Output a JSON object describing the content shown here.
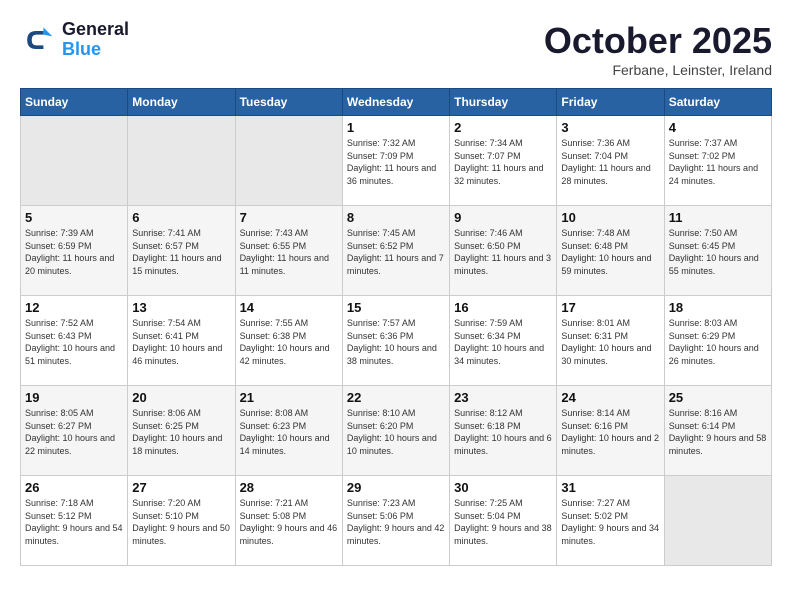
{
  "header": {
    "logo_line1": "General",
    "logo_line2": "Blue",
    "title": "October 2025",
    "subtitle": "Ferbane, Leinster, Ireland"
  },
  "days_of_week": [
    "Sunday",
    "Monday",
    "Tuesday",
    "Wednesday",
    "Thursday",
    "Friday",
    "Saturday"
  ],
  "weeks": [
    [
      {
        "day": "",
        "sunrise": "",
        "sunset": "",
        "daylight": "",
        "empty": true
      },
      {
        "day": "",
        "sunrise": "",
        "sunset": "",
        "daylight": "",
        "empty": true
      },
      {
        "day": "",
        "sunrise": "",
        "sunset": "",
        "daylight": "",
        "empty": true
      },
      {
        "day": "1",
        "sunrise": "Sunrise: 7:32 AM",
        "sunset": "Sunset: 7:09 PM",
        "daylight": "Daylight: 11 hours and 36 minutes."
      },
      {
        "day": "2",
        "sunrise": "Sunrise: 7:34 AM",
        "sunset": "Sunset: 7:07 PM",
        "daylight": "Daylight: 11 hours and 32 minutes."
      },
      {
        "day": "3",
        "sunrise": "Sunrise: 7:36 AM",
        "sunset": "Sunset: 7:04 PM",
        "daylight": "Daylight: 11 hours and 28 minutes."
      },
      {
        "day": "4",
        "sunrise": "Sunrise: 7:37 AM",
        "sunset": "Sunset: 7:02 PM",
        "daylight": "Daylight: 11 hours and 24 minutes."
      }
    ],
    [
      {
        "day": "5",
        "sunrise": "Sunrise: 7:39 AM",
        "sunset": "Sunset: 6:59 PM",
        "daylight": "Daylight: 11 hours and 20 minutes."
      },
      {
        "day": "6",
        "sunrise": "Sunrise: 7:41 AM",
        "sunset": "Sunset: 6:57 PM",
        "daylight": "Daylight: 11 hours and 15 minutes."
      },
      {
        "day": "7",
        "sunrise": "Sunrise: 7:43 AM",
        "sunset": "Sunset: 6:55 PM",
        "daylight": "Daylight: 11 hours and 11 minutes."
      },
      {
        "day": "8",
        "sunrise": "Sunrise: 7:45 AM",
        "sunset": "Sunset: 6:52 PM",
        "daylight": "Daylight: 11 hours and 7 minutes."
      },
      {
        "day": "9",
        "sunrise": "Sunrise: 7:46 AM",
        "sunset": "Sunset: 6:50 PM",
        "daylight": "Daylight: 11 hours and 3 minutes."
      },
      {
        "day": "10",
        "sunrise": "Sunrise: 7:48 AM",
        "sunset": "Sunset: 6:48 PM",
        "daylight": "Daylight: 10 hours and 59 minutes."
      },
      {
        "day": "11",
        "sunrise": "Sunrise: 7:50 AM",
        "sunset": "Sunset: 6:45 PM",
        "daylight": "Daylight: 10 hours and 55 minutes."
      }
    ],
    [
      {
        "day": "12",
        "sunrise": "Sunrise: 7:52 AM",
        "sunset": "Sunset: 6:43 PM",
        "daylight": "Daylight: 10 hours and 51 minutes."
      },
      {
        "day": "13",
        "sunrise": "Sunrise: 7:54 AM",
        "sunset": "Sunset: 6:41 PM",
        "daylight": "Daylight: 10 hours and 46 minutes."
      },
      {
        "day": "14",
        "sunrise": "Sunrise: 7:55 AM",
        "sunset": "Sunset: 6:38 PM",
        "daylight": "Daylight: 10 hours and 42 minutes."
      },
      {
        "day": "15",
        "sunrise": "Sunrise: 7:57 AM",
        "sunset": "Sunset: 6:36 PM",
        "daylight": "Daylight: 10 hours and 38 minutes."
      },
      {
        "day": "16",
        "sunrise": "Sunrise: 7:59 AM",
        "sunset": "Sunset: 6:34 PM",
        "daylight": "Daylight: 10 hours and 34 minutes."
      },
      {
        "day": "17",
        "sunrise": "Sunrise: 8:01 AM",
        "sunset": "Sunset: 6:31 PM",
        "daylight": "Daylight: 10 hours and 30 minutes."
      },
      {
        "day": "18",
        "sunrise": "Sunrise: 8:03 AM",
        "sunset": "Sunset: 6:29 PM",
        "daylight": "Daylight: 10 hours and 26 minutes."
      }
    ],
    [
      {
        "day": "19",
        "sunrise": "Sunrise: 8:05 AM",
        "sunset": "Sunset: 6:27 PM",
        "daylight": "Daylight: 10 hours and 22 minutes."
      },
      {
        "day": "20",
        "sunrise": "Sunrise: 8:06 AM",
        "sunset": "Sunset: 6:25 PM",
        "daylight": "Daylight: 10 hours and 18 minutes."
      },
      {
        "day": "21",
        "sunrise": "Sunrise: 8:08 AM",
        "sunset": "Sunset: 6:23 PM",
        "daylight": "Daylight: 10 hours and 14 minutes."
      },
      {
        "day": "22",
        "sunrise": "Sunrise: 8:10 AM",
        "sunset": "Sunset: 6:20 PM",
        "daylight": "Daylight: 10 hours and 10 minutes."
      },
      {
        "day": "23",
        "sunrise": "Sunrise: 8:12 AM",
        "sunset": "Sunset: 6:18 PM",
        "daylight": "Daylight: 10 hours and 6 minutes."
      },
      {
        "day": "24",
        "sunrise": "Sunrise: 8:14 AM",
        "sunset": "Sunset: 6:16 PM",
        "daylight": "Daylight: 10 hours and 2 minutes."
      },
      {
        "day": "25",
        "sunrise": "Sunrise: 8:16 AM",
        "sunset": "Sunset: 6:14 PM",
        "daylight": "Daylight: 9 hours and 58 minutes."
      }
    ],
    [
      {
        "day": "26",
        "sunrise": "Sunrise: 7:18 AM",
        "sunset": "Sunset: 5:12 PM",
        "daylight": "Daylight: 9 hours and 54 minutes."
      },
      {
        "day": "27",
        "sunrise": "Sunrise: 7:20 AM",
        "sunset": "Sunset: 5:10 PM",
        "daylight": "Daylight: 9 hours and 50 minutes."
      },
      {
        "day": "28",
        "sunrise": "Sunrise: 7:21 AM",
        "sunset": "Sunset: 5:08 PM",
        "daylight": "Daylight: 9 hours and 46 minutes."
      },
      {
        "day": "29",
        "sunrise": "Sunrise: 7:23 AM",
        "sunset": "Sunset: 5:06 PM",
        "daylight": "Daylight: 9 hours and 42 minutes."
      },
      {
        "day": "30",
        "sunrise": "Sunrise: 7:25 AM",
        "sunset": "Sunset: 5:04 PM",
        "daylight": "Daylight: 9 hours and 38 minutes."
      },
      {
        "day": "31",
        "sunrise": "Sunrise: 7:27 AM",
        "sunset": "Sunset: 5:02 PM",
        "daylight": "Daylight: 9 hours and 34 minutes."
      },
      {
        "day": "",
        "sunrise": "",
        "sunset": "",
        "daylight": "",
        "empty": true
      }
    ]
  ]
}
